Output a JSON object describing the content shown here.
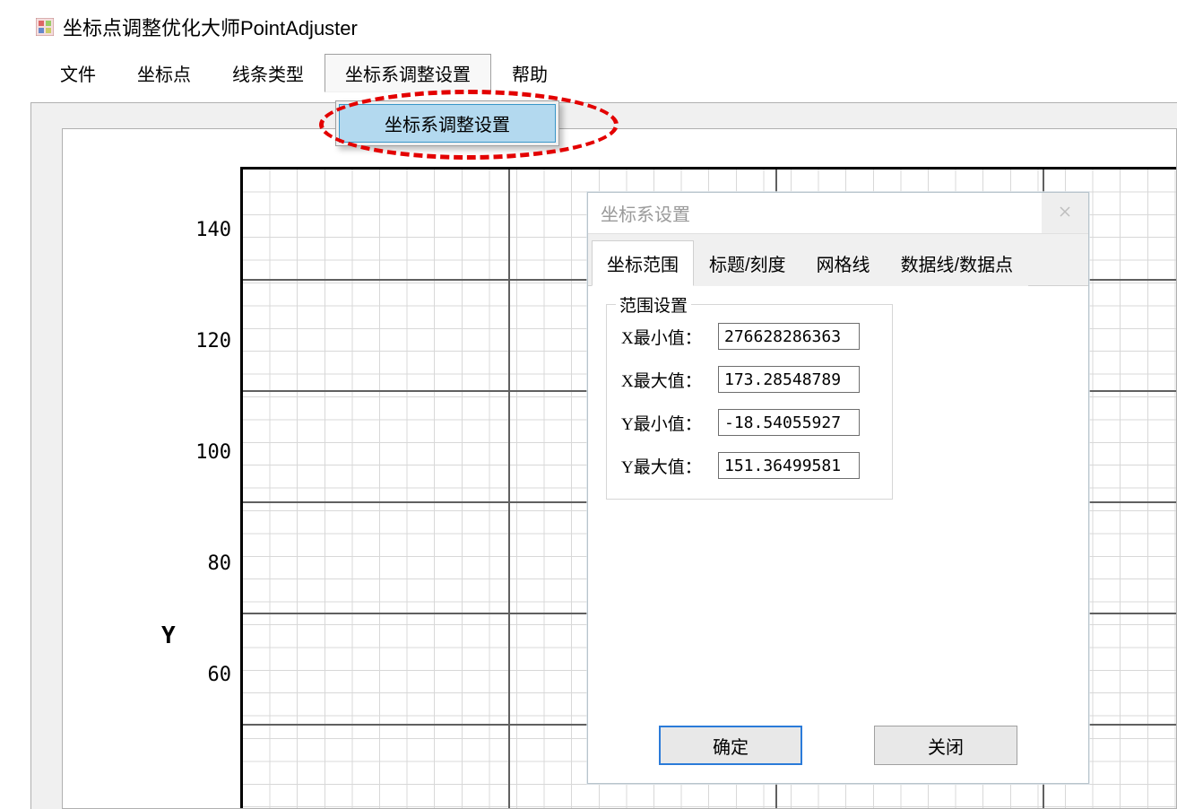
{
  "app": {
    "title": "坐标点调整优化大师PointAdjuster"
  },
  "menu": {
    "items": [
      "文件",
      "坐标点",
      "线条类型",
      "坐标系调整设置",
      "帮助"
    ],
    "dropdown_item": "坐标系调整设置"
  },
  "chart": {
    "y_label": "Y",
    "y_ticks": [
      "140",
      "120",
      "100",
      "80",
      "60"
    ]
  },
  "dialog": {
    "title": "坐标系设置",
    "tabs": [
      "坐标范围",
      "标题/刻度",
      "网格线",
      "数据线/数据点"
    ],
    "group_title": "范围设置",
    "fields": {
      "xmin": {
        "label": "X最小值：",
        "value": "276628286363"
      },
      "xmax": {
        "label": "X最大值：",
        "value": "173.28548789"
      },
      "ymin": {
        "label": "Y最小值：",
        "value": "-18.54055927"
      },
      "ymax": {
        "label": "Y最大值：",
        "value": "151.36499581"
      }
    },
    "ok": "确定",
    "close": "关闭"
  },
  "chart_data": {
    "type": "line",
    "title": "",
    "xlabel": "",
    "ylabel": "Y",
    "ylim": [
      40,
      150
    ],
    "y_ticks": [
      60,
      80,
      100,
      120,
      140
    ],
    "x_range_set": [
      276628286363,
      173.28548789
    ],
    "y_range_set": [
      -18.54055927,
      151.36499581
    ],
    "series": []
  }
}
